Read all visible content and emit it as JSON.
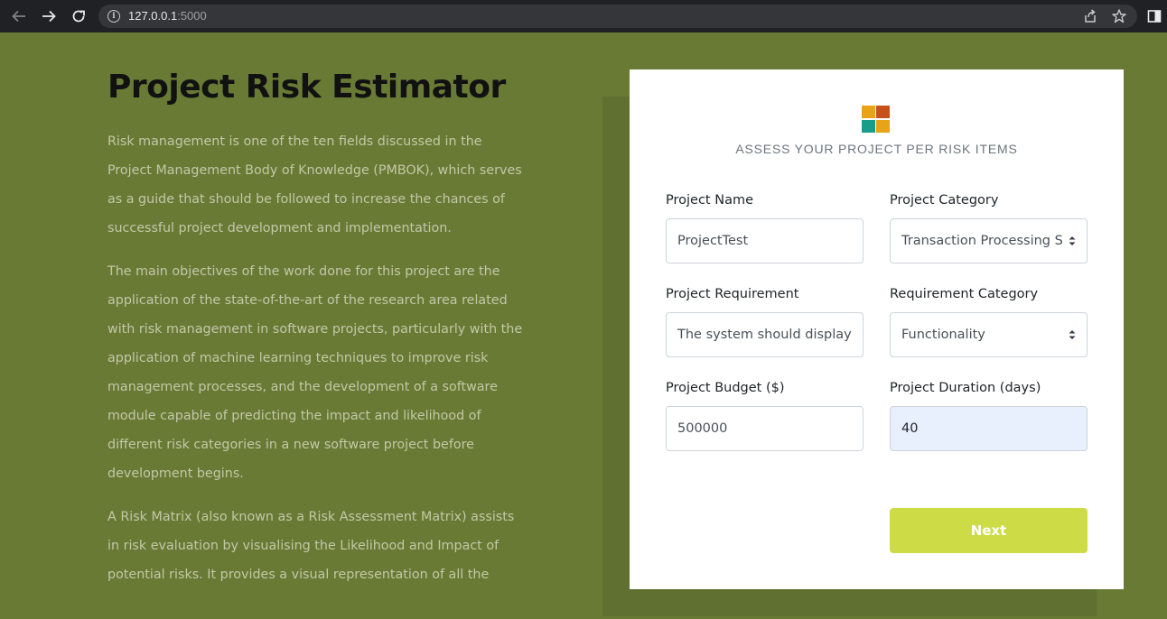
{
  "browser": {
    "url_host": "127.0.0.1",
    "url_port": ":5000",
    "back_icon": "arrow-left-icon",
    "forward_icon": "arrow-right-icon",
    "reload_icon": "reload-icon",
    "info_icon": "site-info-icon",
    "share_icon": "share-icon",
    "bookmark_icon": "star-icon",
    "sidepanel_icon": "side-panel-icon"
  },
  "main": {
    "title": "Project Risk Estimator",
    "paragraphs": [
      "Risk management is one of the ten fields discussed in the Project Management Body of Knowledge (PMBOK), which serves as a guide that should be followed to increase the chances of successful project development and implementation.",
      "The main objectives of the work done for this project are the application of the state-of-the-art of the research area related with risk management in software projects, particularly with the application of machine learning techniques to improve risk management processes, and the development of a software module capable of predicting the impact and likelihood of different risk categories in a new software project before development begins.",
      "A Risk Matrix (also known as a Risk Assessment Matrix) assists in risk evaluation by visualising the Likelihood and Impact of potential risks. It provides a visual representation of all the"
    ]
  },
  "form": {
    "logo_icon": "four-square-logo-icon",
    "logo_colors": [
      "#e8a317",
      "#c8511b",
      "#1a9c8a",
      "#e8a317"
    ],
    "subtitle": "ASSESS YOUR PROJECT PER RISK ITEMS",
    "project_name": {
      "label": "Project Name",
      "value": "ProjectTest"
    },
    "project_category": {
      "label": "Project Category",
      "value": "Transaction Processing S"
    },
    "project_requirement": {
      "label": "Project Requirement",
      "value": "The system should display"
    },
    "requirement_category": {
      "label": "Requirement Category",
      "value": "Functionality"
    },
    "project_budget": {
      "label": "Project Budget ($)",
      "value": "500000"
    },
    "project_duration": {
      "label": "Project Duration (days)",
      "value": "40"
    },
    "next_label": "Next",
    "accent_color": "#cddc46"
  }
}
